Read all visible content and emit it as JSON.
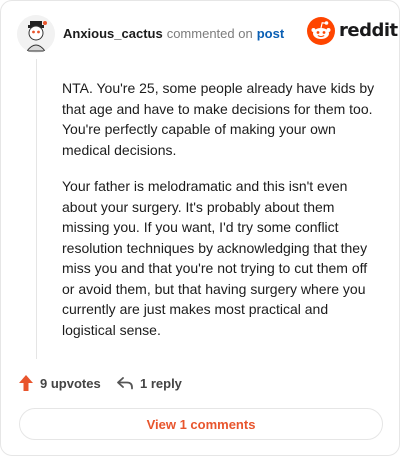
{
  "comment": {
    "username": "Anxious_cactus",
    "action_text": "commented on",
    "post_link": "post",
    "paragraphs": [
      "NTA. You're 25, some people already have kids by that age and have to make decisions for them too. You're perfectly capable of making your own medical decisions.",
      "Your father is melodramatic and this isn't even about your surgery. It's probably about them missing you. If you want, I'd try some conflict resolution techniques by acknowledging that they miss you and that you're not trying to cut them off or avoid them, but that having surgery where you currently are just makes most practical and logistical sense."
    ]
  },
  "brand": {
    "name": "reddit",
    "icon": "reddit-logo-icon",
    "color": "#FF4500"
  },
  "actions": {
    "upvotes_label": "9 upvotes",
    "upvote_icon": "upvote-arrow-icon",
    "reply_label": "1 reply",
    "reply_icon": "reply-arrow-icon"
  },
  "view_comments_label": "View 1 comments",
  "colors": {
    "accent": "#E8552D",
    "link": "#0A5FB4",
    "muted": "#7C7C7C"
  }
}
